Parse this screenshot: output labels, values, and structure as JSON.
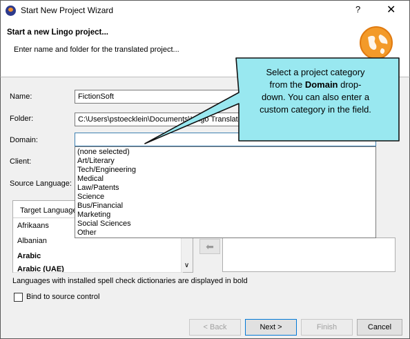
{
  "window": {
    "title": "Start New Project Wizard",
    "help": "?",
    "close": "✕"
  },
  "banner": {
    "title": "Start a new Lingo project...",
    "subtitle": "Enter name and folder for the translated project..."
  },
  "form": {
    "name_label": "Name:",
    "name_value": "FictionSoft",
    "folder_label": "Folder:",
    "folder_value": "C:\\Users\\pstoecklein\\Documents\\Lingo Translated",
    "browse_label": "...",
    "domain_label": "Domain:",
    "domain_value": "",
    "client_label": "Client:",
    "source_language_label": "Source Language:"
  },
  "domain_options": [
    "(none selected)",
    "Art/Literary",
    "Tech/Engineering",
    "Medical",
    "Law/Patents",
    "Science",
    "Bus/Financial",
    "Marketing",
    "Social Sciences",
    "Other"
  ],
  "target_languages": {
    "header": "Target Language",
    "items": [
      {
        "label": "Afrikaans",
        "bold": false
      },
      {
        "label": "Albanian",
        "bold": false
      },
      {
        "label": "Arabic",
        "bold": true
      },
      {
        "label": "Arabic (UAE)",
        "bold": true
      }
    ]
  },
  "move_left_icon": "arrow-left-icon",
  "spell_note": "Languages with installed spell check dictionaries are displayed in bold",
  "bind_checkbox": {
    "label": "Bind to source control",
    "checked": false
  },
  "buttons": {
    "back": "< Back",
    "next": "Next >",
    "finish": "Finish",
    "cancel": "Cancel"
  },
  "callout": {
    "line1": "Select a project category",
    "line2_pre": "from the ",
    "line2_bold": "Domain",
    "line2_post": " drop-",
    "line3": "down. You can also enter a",
    "line4": "custom category in the field."
  },
  "colors": {
    "callout_fill": "#99e8f0",
    "globe": "#f39a29",
    "accent": "#0078d7"
  }
}
